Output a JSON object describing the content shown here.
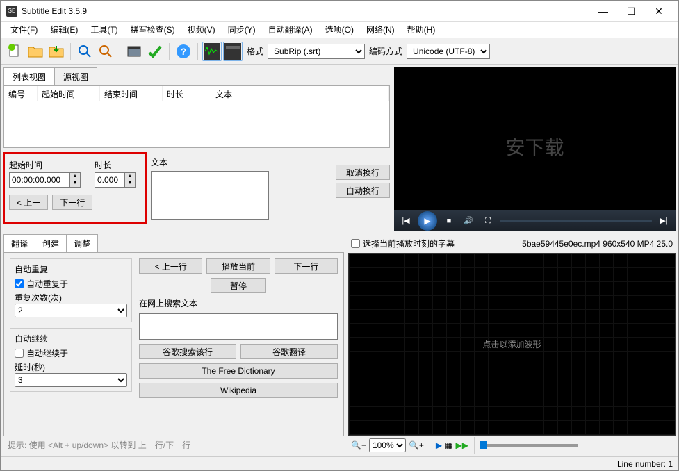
{
  "titlebar": {
    "title": "Subtitle Edit 3.5.9",
    "app_icon": "SE"
  },
  "menubar": [
    "文件(F)",
    "编辑(E)",
    "工具(T)",
    "拼写检查(S)",
    "视频(V)",
    "同步(Y)",
    "自动翻译(A)",
    "选项(O)",
    "网络(N)",
    "帮助(H)"
  ],
  "toolbar": {
    "format_label": "格式",
    "format_value": "SubRip (.srt)",
    "encoding_label": "编码方式",
    "encoding_value": "Unicode (UTF-8)"
  },
  "tabs": {
    "list_view": "列表视图",
    "source_view": "源视图"
  },
  "list_headers": {
    "index": "编号",
    "start": "起始时间",
    "end": "结束时间",
    "duration": "时长",
    "text": "文本"
  },
  "edit": {
    "start_label": "起始时间",
    "duration_label": "时长",
    "start_value": "00:00:00.000",
    "duration_value": "0.000",
    "prev_btn": "< 上一",
    "next_btn": "下一行",
    "text_label": "文本",
    "unbreak_btn": "取消换行",
    "autobreak_btn": "自动换行"
  },
  "trans": {
    "tabs": [
      "翻译",
      "创建",
      "调整"
    ],
    "auto_repeat_group": "自动重复",
    "auto_repeat_on": "自动重复于",
    "repeat_count_label": "重复次数(次)",
    "repeat_count_value": "2",
    "auto_continue_group": "自动继续",
    "auto_continue_on": "自动继续于",
    "delay_label": "延时(秒)",
    "delay_value": "3",
    "prev_line": "< 上一行",
    "play_current": "播放当前",
    "next_line": "下一行",
    "pause": "暂停",
    "search_label": "在网上搜索文本",
    "google_search_line": "谷歌搜索该行",
    "google_translate": "谷歌翻译",
    "free_dict": "The Free Dictionary",
    "wikipedia": "Wikipedia",
    "hint": "提示: 使用 <Alt + up/down> 以转到 上一行/下一行"
  },
  "wave": {
    "checkbox": "选择当前播放时刻的字幕",
    "fileinfo": "5bae59445e0ec.mp4 960x540 MP4 25.0",
    "placeholder": "点击以添加波形",
    "zoom": "100%"
  },
  "status": {
    "line_number": "Line number: 1"
  },
  "watermark": "安下载"
}
